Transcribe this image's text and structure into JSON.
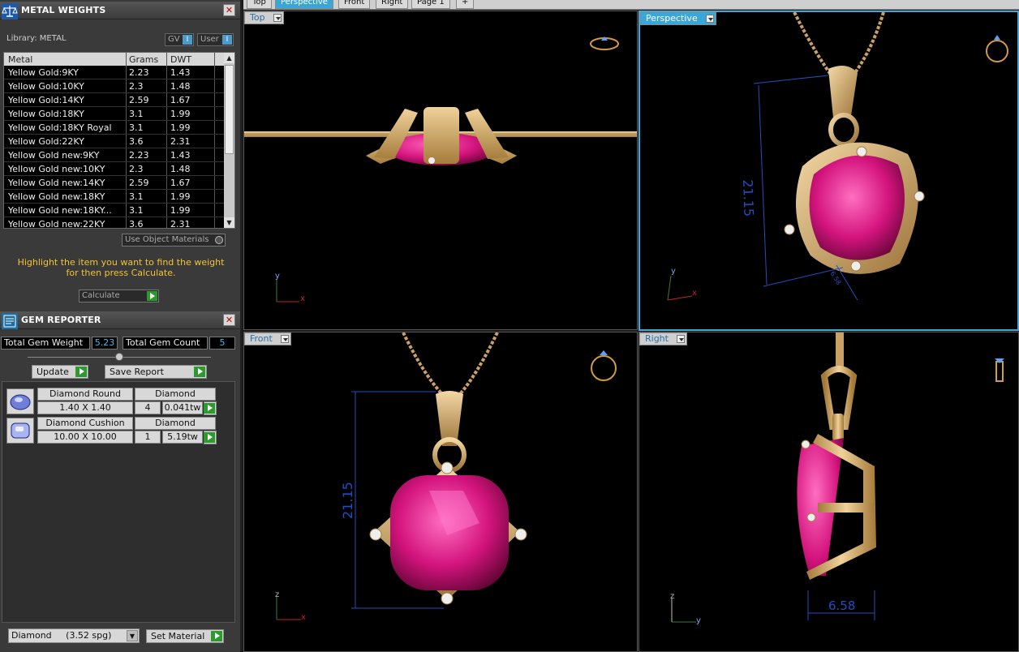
{
  "metal_weights": {
    "title": "METAL WEIGHTS",
    "close": "✕",
    "library_label": "Library: METAL",
    "gv_toggle": "GV",
    "user_toggle": "User",
    "toggle_mark": "I",
    "columns": [
      "Metal",
      "Grams",
      "DWT"
    ],
    "rows": [
      {
        "metal": "Yellow Gold:9KY",
        "grams": "2.23",
        "dwt": "1.43"
      },
      {
        "metal": "Yellow Gold:10KY",
        "grams": "2.3",
        "dwt": "1.48"
      },
      {
        "metal": "Yellow Gold:14KY",
        "grams": "2.59",
        "dwt": "1.67"
      },
      {
        "metal": "Yellow Gold:18KY",
        "grams": "3.1",
        "dwt": "1.99"
      },
      {
        "metal": "Yellow Gold:18KY Royal",
        "grams": "3.1",
        "dwt": "1.99"
      },
      {
        "metal": "Yellow Gold:22KY",
        "grams": "3.6",
        "dwt": "2.31"
      },
      {
        "metal": "Yellow Gold new:9KY",
        "grams": "2.23",
        "dwt": "1.43"
      },
      {
        "metal": "Yellow Gold new:10KY",
        "grams": "2.3",
        "dwt": "1.48"
      },
      {
        "metal": "Yellow Gold new:14KY",
        "grams": "2.59",
        "dwt": "1.67"
      },
      {
        "metal": "Yellow Gold new:18KY",
        "grams": "3.1",
        "dwt": "1.99"
      },
      {
        "metal": "Yellow Gold new:18KY...",
        "grams": "3.1",
        "dwt": "1.99"
      },
      {
        "metal": "Yellow Gold new:22KY",
        "grams": "3.6",
        "dwt": "2.31"
      }
    ],
    "use_object_materials": "Use Object Materials",
    "hint_line1": "Highlight the item you want to find the weight",
    "hint_line2": "for then press Calculate.",
    "calculate": "Calculate"
  },
  "gem_reporter": {
    "title": "GEM REPORTER",
    "close": "✕",
    "total_weight_label": "Total Gem Weight",
    "total_weight_value": "5.23",
    "total_count_label": "Total Gem Count",
    "total_count_value": "5",
    "update": "Update",
    "save_report": "Save Report",
    "gems": [
      {
        "name": "Diamond Round",
        "material": "Diamond",
        "size": "1.40 X 1.40",
        "count": "4",
        "weight": "0.041tw"
      },
      {
        "name": "Diamond Cushion",
        "material": "Diamond",
        "size": "10.00 X 10.00",
        "count": "1",
        "weight": "5.19tw"
      }
    ],
    "material_select": "Diamond     (3.52 spg)",
    "set_material": "Set Material"
  },
  "tabs": [
    "Top",
    "Perspective",
    "Front",
    "Right",
    "Page 1",
    "+"
  ],
  "active_tab": "Perspective",
  "viewports": {
    "top": {
      "label": "Top",
      "axis_a": "y",
      "axis_b": "x"
    },
    "perspective": {
      "label": "Perspective",
      "dimension": "21.15",
      "dimension_small": "6.58",
      "axis_a": "y",
      "axis_b": "x"
    },
    "front": {
      "label": "Front",
      "dimension": "21.15",
      "axis_a": "z",
      "axis_b": "x"
    },
    "right": {
      "label": "Right",
      "dimension": "6.58",
      "axis_a": "z",
      "axis_b": "y"
    }
  },
  "colors": {
    "gold": "#d9b26a",
    "ruby": "#d4147e",
    "accent": "#3aa7d9",
    "hint": "#f2c433",
    "dimension": "#1f4fbf"
  }
}
